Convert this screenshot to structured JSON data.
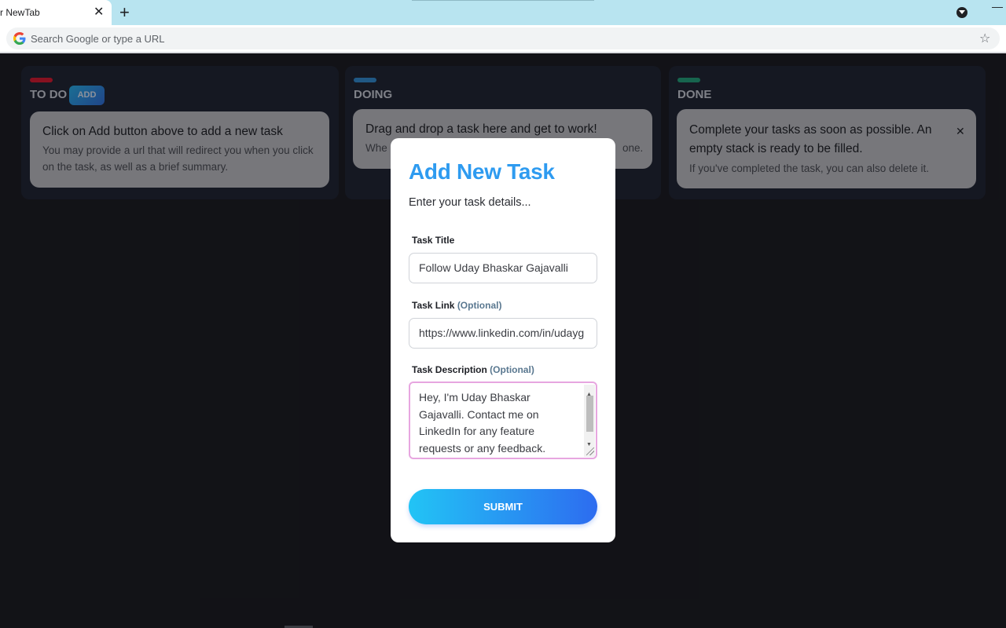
{
  "browser": {
    "tab_title": "r NewTab",
    "tab_close": "✕",
    "new_tab": "+",
    "omnibox_placeholder": "Search Google or type a URL",
    "minimize": "—",
    "icons": [
      "google-g-icon",
      "star-icon",
      "tab-search-icon",
      "close-icon",
      "plus-icon"
    ]
  },
  "board": {
    "columns": [
      {
        "title": "TO DO",
        "color": "#e0162b",
        "add_label": "ADD",
        "card": {
          "title": "Click on Add button above to add a new task",
          "description": "You may provide a url that will redirect you when you click on the task, as well as a brief summary."
        }
      },
      {
        "title": "DOING",
        "color": "#2f8fd8",
        "card": {
          "title": "Drag and drop a task here and get to work!",
          "description_start": "Whe",
          "description_end": "one."
        }
      },
      {
        "title": "DONE",
        "color": "#1fa67a",
        "card": {
          "title": "Complete your tasks as soon as possible. An empty stack is ready to be filled.",
          "description": "If you've completed the task, you can also delete it.",
          "close": "✕"
        }
      }
    ]
  },
  "modal": {
    "title": "Add New Task",
    "subtitle": "Enter your task details...",
    "title_label": "Task Title",
    "title_value": "Follow Uday Bhaskar Gajavalli",
    "link_label": "Task Link",
    "link_optional": "(Optional)",
    "link_value": "https://www.linkedin.com/in/udayg",
    "desc_label": "Task Description",
    "desc_optional": "(Optional)",
    "desc_value": "Hey, I'm Uday Bhaskar Gajavalli. Contact me on LinkedIn for any feature requests or any feedback.",
    "submit_label": "SUBMIT"
  }
}
